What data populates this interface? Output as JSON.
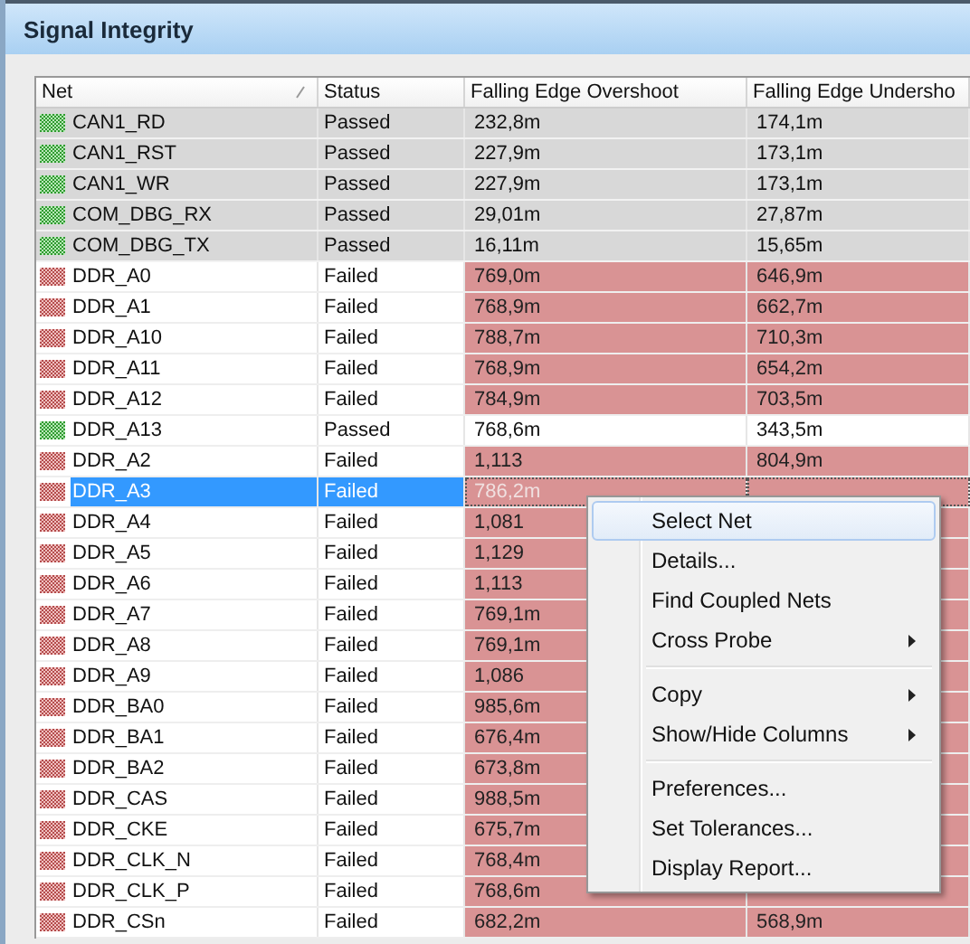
{
  "window": {
    "title": "Signal Integrity"
  },
  "columns": [
    {
      "label": "Net",
      "sorted": true
    },
    {
      "label": "Status",
      "sorted": false
    },
    {
      "label": "Falling Edge Overshoot",
      "sorted": false
    },
    {
      "label": "Falling Edge Undersho",
      "sorted": false
    }
  ],
  "rows": [
    {
      "net": "CAN1_RD",
      "status": "Passed",
      "passed": true,
      "shaded": true,
      "selected": false,
      "overshoot": "232,8m",
      "undershoot": "174,1m"
    },
    {
      "net": "CAN1_RST",
      "status": "Passed",
      "passed": true,
      "shaded": true,
      "selected": false,
      "overshoot": "227,9m",
      "undershoot": "173,1m"
    },
    {
      "net": "CAN1_WR",
      "status": "Passed",
      "passed": true,
      "shaded": true,
      "selected": false,
      "overshoot": "227,9m",
      "undershoot": "173,1m"
    },
    {
      "net": "COM_DBG_RX",
      "status": "Passed",
      "passed": true,
      "shaded": true,
      "selected": false,
      "overshoot": "29,01m",
      "undershoot": "27,87m"
    },
    {
      "net": "COM_DBG_TX",
      "status": "Passed",
      "passed": true,
      "shaded": true,
      "selected": false,
      "overshoot": "16,11m",
      "undershoot": "15,65m"
    },
    {
      "net": "DDR_A0",
      "status": "Failed",
      "passed": false,
      "shaded": false,
      "selected": false,
      "overshoot": "769,0m",
      "undershoot": "646,9m"
    },
    {
      "net": "DDR_A1",
      "status": "Failed",
      "passed": false,
      "shaded": false,
      "selected": false,
      "overshoot": "768,9m",
      "undershoot": "662,7m"
    },
    {
      "net": "DDR_A10",
      "status": "Failed",
      "passed": false,
      "shaded": false,
      "selected": false,
      "overshoot": "788,7m",
      "undershoot": "710,3m"
    },
    {
      "net": "DDR_A11",
      "status": "Failed",
      "passed": false,
      "shaded": false,
      "selected": false,
      "overshoot": "768,9m",
      "undershoot": "654,2m"
    },
    {
      "net": "DDR_A12",
      "status": "Failed",
      "passed": false,
      "shaded": false,
      "selected": false,
      "overshoot": "784,9m",
      "undershoot": "703,5m"
    },
    {
      "net": "DDR_A13",
      "status": "Passed",
      "passed": true,
      "shaded": false,
      "selected": false,
      "overshoot": "768,6m",
      "undershoot": "343,5m"
    },
    {
      "net": "DDR_A2",
      "status": "Failed",
      "passed": false,
      "shaded": false,
      "selected": false,
      "overshoot": "1,113",
      "undershoot": "804,9m"
    },
    {
      "net": "DDR_A3",
      "status": "Failed",
      "passed": false,
      "shaded": false,
      "selected": true,
      "overshoot": "786,2m"
    },
    {
      "net": "DDR_A4",
      "status": "Failed",
      "passed": false,
      "shaded": false,
      "selected": false,
      "overshoot": "1,081"
    },
    {
      "net": "DDR_A5",
      "status": "Failed",
      "passed": false,
      "shaded": false,
      "selected": false,
      "overshoot": "1,129"
    },
    {
      "net": "DDR_A6",
      "status": "Failed",
      "passed": false,
      "shaded": false,
      "selected": false,
      "overshoot": "1,113"
    },
    {
      "net": "DDR_A7",
      "status": "Failed",
      "passed": false,
      "shaded": false,
      "selected": false,
      "overshoot": "769,1m"
    },
    {
      "net": "DDR_A8",
      "status": "Failed",
      "passed": false,
      "shaded": false,
      "selected": false,
      "overshoot": "769,1m"
    },
    {
      "net": "DDR_A9",
      "status": "Failed",
      "passed": false,
      "shaded": false,
      "selected": false,
      "overshoot": "1,086"
    },
    {
      "net": "DDR_BA0",
      "status": "Failed",
      "passed": false,
      "shaded": false,
      "selected": false,
      "overshoot": "985,6m"
    },
    {
      "net": "DDR_BA1",
      "status": "Failed",
      "passed": false,
      "shaded": false,
      "selected": false,
      "overshoot": "676,4m"
    },
    {
      "net": "DDR_BA2",
      "status": "Failed",
      "passed": false,
      "shaded": false,
      "selected": false,
      "overshoot": "673,8m"
    },
    {
      "net": "DDR_CAS",
      "status": "Failed",
      "passed": false,
      "shaded": false,
      "selected": false,
      "overshoot": "988,5m"
    },
    {
      "net": "DDR_CKE",
      "status": "Failed",
      "passed": false,
      "shaded": false,
      "selected": false,
      "overshoot": "675,7m"
    },
    {
      "net": "DDR_CLK_N",
      "status": "Failed",
      "passed": false,
      "shaded": false,
      "selected": false,
      "overshoot": "768,4m"
    },
    {
      "net": "DDR_CLK_P",
      "status": "Failed",
      "passed": false,
      "shaded": false,
      "selected": false,
      "overshoot": "768,6m"
    },
    {
      "net": "DDR_CSn",
      "status": "Failed",
      "passed": false,
      "shaded": false,
      "selected": false,
      "overshoot": "682,2m",
      "undershoot": "568,9m"
    }
  ],
  "context_menu": {
    "items": [
      {
        "kind": "item",
        "label": "Select Net",
        "selected": true,
        "submenu": false
      },
      {
        "kind": "item",
        "label": "Details...",
        "selected": false,
        "submenu": false
      },
      {
        "kind": "item",
        "label": "Find Coupled Nets",
        "selected": false,
        "submenu": false
      },
      {
        "kind": "item",
        "label": "Cross Probe",
        "selected": false,
        "submenu": true
      },
      {
        "kind": "separator"
      },
      {
        "kind": "item",
        "label": "Copy",
        "selected": false,
        "submenu": true
      },
      {
        "kind": "item",
        "label": "Show/Hide Columns",
        "selected": false,
        "submenu": true
      },
      {
        "kind": "separator"
      },
      {
        "kind": "item",
        "label": "Preferences...",
        "selected": false,
        "submenu": false
      },
      {
        "kind": "item",
        "label": "Set Tolerances...",
        "selected": false,
        "submenu": false
      },
      {
        "kind": "item",
        "label": "Display Report...",
        "selected": false,
        "submenu": false
      }
    ]
  }
}
